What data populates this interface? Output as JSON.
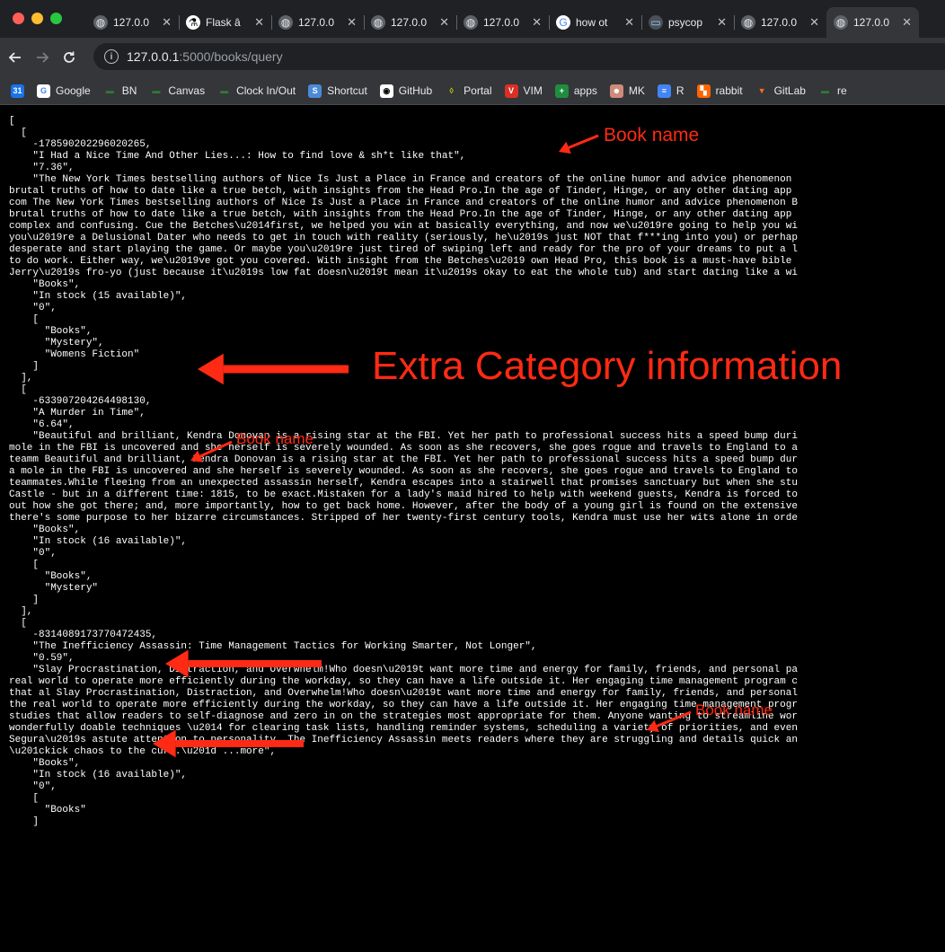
{
  "browser": {
    "tabs": [
      {
        "label": "127.0.0",
        "icon": "globe-icon"
      },
      {
        "label": "Flask â",
        "icon": "flask-icon"
      },
      {
        "label": "127.0.0",
        "icon": "globe-icon"
      },
      {
        "label": "127.0.0",
        "icon": "globe-icon"
      },
      {
        "label": "127.0.0",
        "icon": "globe-icon"
      },
      {
        "label": "how ot",
        "icon": "google-icon"
      },
      {
        "label": "psycop",
        "icon": "terminal-icon"
      },
      {
        "label": "127.0.0",
        "icon": "globe-icon"
      },
      {
        "label": "127.0.0",
        "icon": "globe-icon"
      }
    ],
    "url_host": "127.0.0.1",
    "url_path": ":5000/books/query",
    "bookmarks": [
      {
        "label": "",
        "icon": "calendar-icon"
      },
      {
        "label": "Google",
        "icon": "google-icon"
      },
      {
        "label": "BN",
        "icon": "bookmark-icon"
      },
      {
        "label": "Canvas",
        "icon": "bookmark-icon"
      },
      {
        "label": "Clock In/Out",
        "icon": "bookmark-icon"
      },
      {
        "label": "Shortcut",
        "icon": "shortcut-icon"
      },
      {
        "label": "GitHub",
        "icon": "github-icon"
      },
      {
        "label": "Portal",
        "icon": "portal-icon"
      },
      {
        "label": "VIM",
        "icon": "vim-icon"
      },
      {
        "label": "apps",
        "icon": "apps-icon"
      },
      {
        "label": "MK",
        "icon": "mk-icon"
      },
      {
        "label": "R",
        "icon": "docs-icon"
      },
      {
        "label": "rabbit",
        "icon": "rabbit-icon"
      },
      {
        "label": "GitLab",
        "icon": "gitlab-icon"
      },
      {
        "label": "re",
        "icon": "bookmark-icon"
      }
    ]
  },
  "response_text": "[\n  [\n    -178590202296020265,\n    \"I Had a Nice Time And Other Lies...: How to find love & sh*t like that\",\n    \"7.36\",\n    \"The New York Times bestselling authors of Nice Is Just a Place in France and creators of the online humor and advice phenomenon\nbrutal truths of how to date like a true betch, with insights from the Head Pro.In the age of Tinder, Hinge, or any other dating app\ncom The New York Times bestselling authors of Nice Is Just a Place in France and creators of the online humor and advice phenomenon B\nbrutal truths of how to date like a true betch, with insights from the Head Pro.In the age of Tinder, Hinge, or any other dating app\ncomplex and confusing. Cue the Betches\\u2014first, we helped you win at basically everything, and now we\\u2019re going to help you wi\nyou\\u2019re a Delusional Dater who needs to get in touch with reality (seriously, he\\u2019s just NOT that f***ing into you) or perhap\ndesperate and start playing the game. Or maybe you\\u2019re just tired of swiping left and ready for the pro of your dreams to put a l\nto do work. Either way, we\\u2019ve got you covered. With insight from the Betches\\u2019 own Head Pro, this book is a must-have bible\nJerry\\u2019s fro-yo (just because it\\u2019s low fat doesn\\u2019t mean it\\u2019s okay to eat the whole tub) and start dating like a wi\n    \"Books\",\n    \"In stock (15 available)\",\n    \"0\",\n    [\n      \"Books\",\n      \"Mystery\",\n      \"Womens Fiction\"\n    ]\n  ],\n  [\n    -633907204264498130,\n    \"A Murder in Time\",\n    \"6.64\",\n    \"Beautiful and brilliant, Kendra Donovan is a rising star at the FBI. Yet her path to professional success hits a speed bump duri\nmole in the FBI is uncovered and she herself is severely wounded. As soon as she recovers, she goes rogue and travels to England to a\nteamm Beautiful and brilliant, Kendra Donovan is a rising star at the FBI. Yet her path to professional success hits a speed bump dur\na mole in the FBI is uncovered and she herself is severely wounded. As soon as she recovers, she goes rogue and travels to England to\nteammates.While fleeing from an unexpected assassin herself, Kendra escapes into a stairwell that promises sanctuary but when she stu\nCastle - but in a different time: 1815, to be exact.Mistaken for a lady's maid hired to help with weekend guests, Kendra is forced to\nout how she got there; and, more importantly, how to get back home. However, after the body of a young girl is found on the extensive\nthere's some purpose to her bizarre circumstances. Stripped of her twenty-first century tools, Kendra must use her wits alone in orde\n    \"Books\",\n    \"In stock (16 available)\",\n    \"0\",\n    [\n      \"Books\",\n      \"Mystery\"\n    ]\n  ],\n  [\n    -8314089173770472435,\n    \"The Inefficiency Assassin: Time Management Tactics for Working Smarter, Not Longer\",\n    \"0.59\",\n    \"Slay Procrastination, Distraction, and Overwhelm!Who doesn\\u2019t want more time and energy for family, friends, and personal pa\nreal world to operate more efficiently during the workday, so they can have a life outside it. Her engaging time management program c\nthat al Slay Procrastination, Distraction, and Overwhelm!Who doesn\\u2019t want more time and energy for family, friends, and personal\nthe real world to operate more efficiently during the workday, so they can have a life outside it. Her engaging time management progr\nstudies that allow readers to self-diagnose and zero in on the strategies most appropriate for them. Anyone wanting to streamline wor\nwonderfully doable techniques \\u2014 for clearing task lists, handling reminder systems, scheduling a variety of priorities, and even\nSegura\\u2019s astute attention to personality, The Inefficiency Assassin meets readers where they are struggling and details quick an\n\\u201ckick chaos to the curb.\\u201d ...more\",\n    \"Books\",\n    \"In stock (16 available)\",\n    \"0\",\n    [\n      \"Books\"\n    ]",
  "annotations": {
    "book_name_label": "Book name",
    "extra_category_label": "Extra Category information",
    "arrow_color": "#ff2a14"
  }
}
